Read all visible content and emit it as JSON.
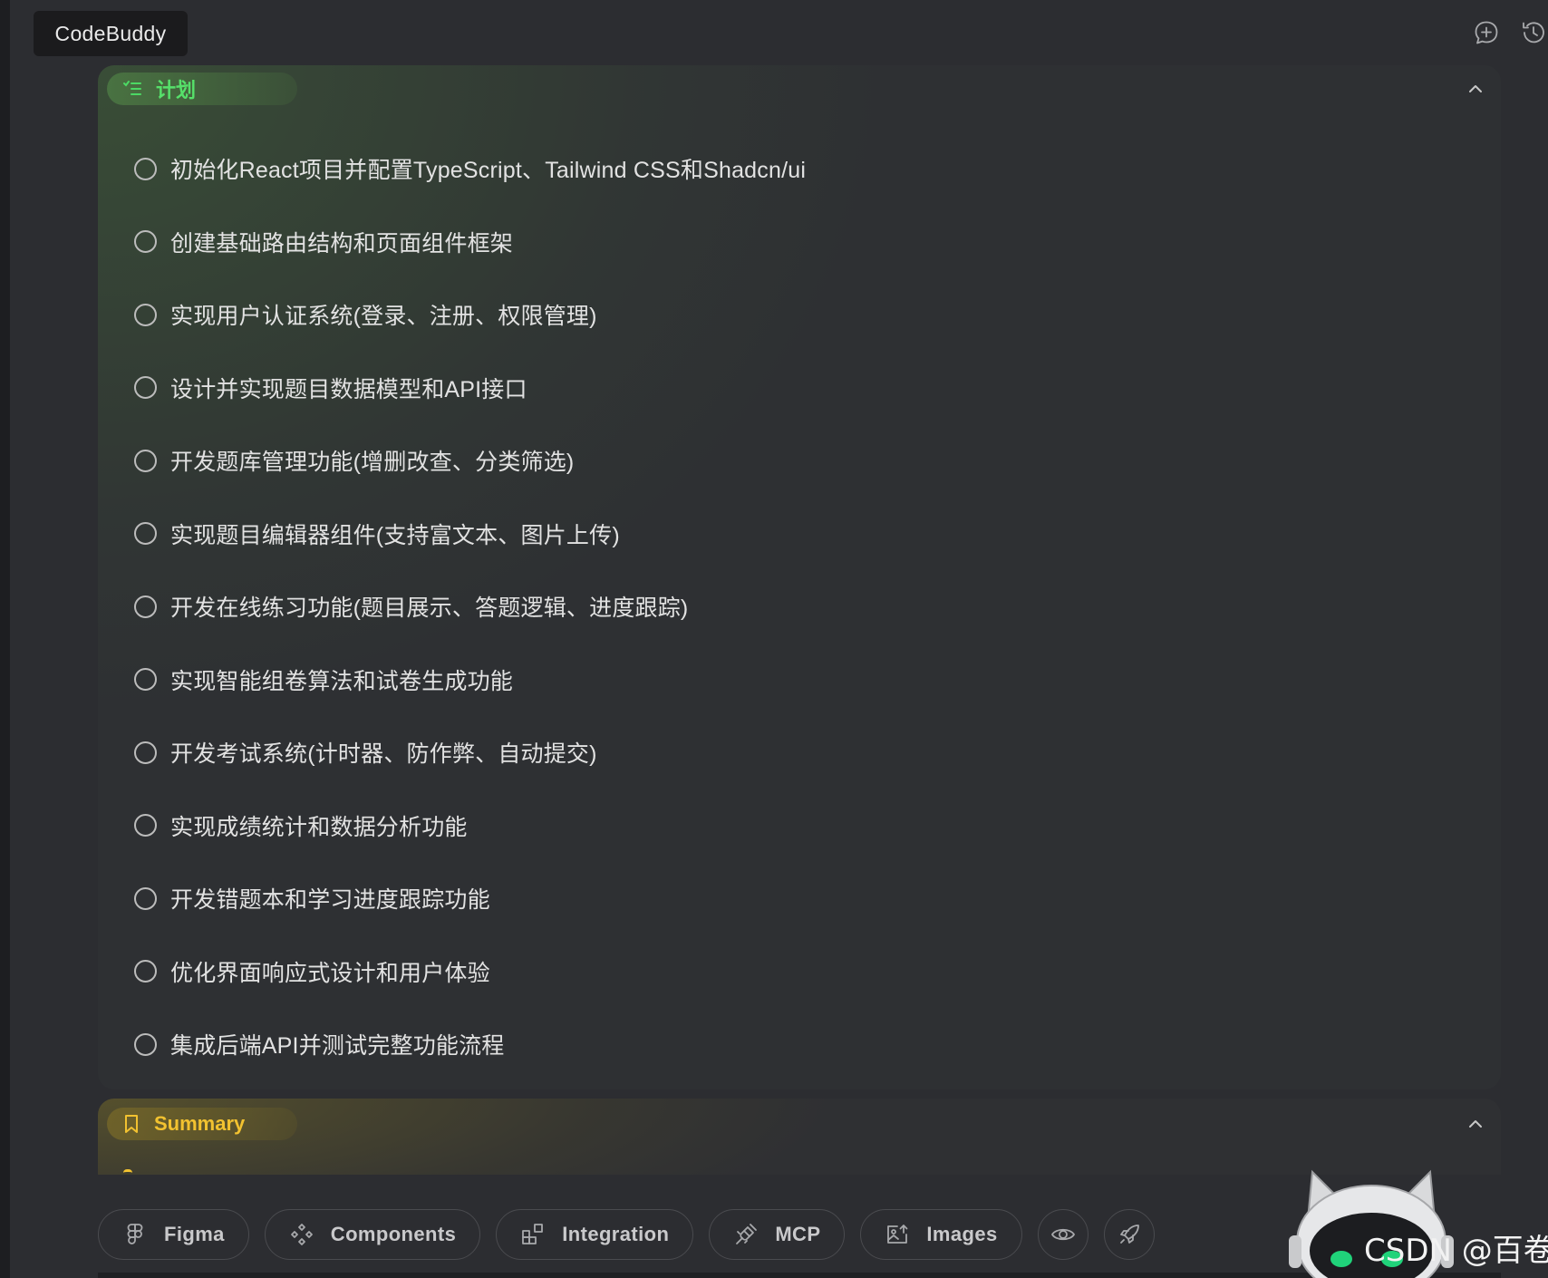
{
  "app": {
    "title": "CodeBuddy"
  },
  "header": {
    "icons": [
      "new-chat-icon",
      "history-icon"
    ]
  },
  "plan": {
    "title": "计划",
    "accent": "#56e06a",
    "tasks": [
      "初始化React项目并配置TypeScript、Tailwind CSS和Shadcn/ui",
      "创建基础路由结构和页面组件框架",
      "实现用户认证系统(登录、注册、权限管理)",
      "设计并实现题目数据模型和API接口",
      "开发题库管理功能(增删改查、分类筛选)",
      "实现题目编辑器组件(支持富文本、图片上传)",
      "开发在线练习功能(题目展示、答题逻辑、进度跟踪)",
      "实现智能组卷算法和试卷生成功能",
      "开发考试系统(计时器、防作弊、自动提交)",
      "实现成绩统计和数据分析功能",
      "开发错题本和学习进度跟踪功能",
      "优化界面响应式设计和用户体验",
      "集成后端API并测试完整功能流程"
    ]
  },
  "summary": {
    "title": "Summary",
    "accent": "#f2c230"
  },
  "toolbar": {
    "figma": "Figma",
    "components": "Components",
    "integration": "Integration",
    "mcp": "MCP",
    "images": "Images"
  },
  "watermark": "CSDN @百卷"
}
